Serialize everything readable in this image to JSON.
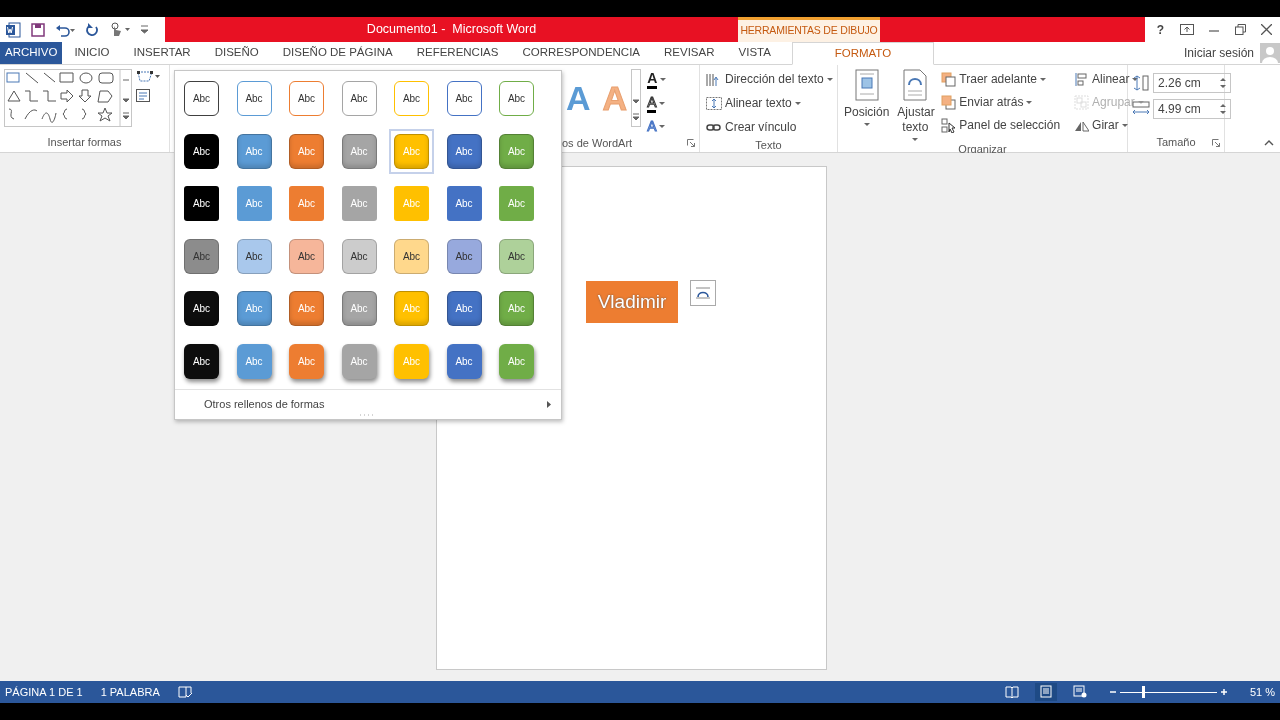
{
  "window": {
    "title": "Documento1 -  Microsoft Word",
    "context_group": "HERRAMIENTAS DE DIBUJO",
    "help": "?",
    "sign_in": "Iniciar sesión"
  },
  "tabs": [
    {
      "label": "ARCHIVO",
      "kind": "file",
      "selected": false
    },
    {
      "label": "INICIO",
      "kind": "normal",
      "selected": false
    },
    {
      "label": "INSERTAR",
      "kind": "normal",
      "selected": false
    },
    {
      "label": "DISEÑO",
      "kind": "normal",
      "selected": false
    },
    {
      "label": "DISEÑO DE PÁGINA",
      "kind": "normal",
      "selected": false
    },
    {
      "label": "REFERENCIAS",
      "kind": "normal",
      "selected": false
    },
    {
      "label": "CORRESPONDENCIA",
      "kind": "normal",
      "selected": false
    },
    {
      "label": "REVISAR",
      "kind": "normal",
      "selected": false
    },
    {
      "label": "VISTA",
      "kind": "normal",
      "selected": false
    },
    {
      "label": "FORMATO",
      "kind": "context",
      "selected": true
    }
  ],
  "ribbon": {
    "insert_shapes": {
      "label": "Insertar formas"
    },
    "wordart": {
      "label": "os de WordArt",
      "quick_styles": [
        {
          "glyph": "A",
          "color": "#5b9bd5"
        },
        {
          "glyph": "A",
          "color": "#f4b183"
        }
      ],
      "tools": [
        {
          "glyph": "A",
          "kind": "fill"
        },
        {
          "glyph": "A",
          "kind": "outline"
        },
        {
          "glyph": "A",
          "kind": "effects"
        }
      ]
    },
    "text": {
      "label": "Texto",
      "items": [
        {
          "label": "Dirección del texto",
          "kind": "direction",
          "dropdown": true
        },
        {
          "label": "Alinear texto",
          "kind": "align",
          "dropdown": true
        },
        {
          "label": "Crear vínculo",
          "kind": "link",
          "dropdown": false
        }
      ]
    },
    "arrange": {
      "label": "Organizar",
      "large": [
        {
          "label": "Posición",
          "kind": "position"
        },
        {
          "label": "Ajustar texto",
          "kind": "wrap"
        }
      ],
      "small": [
        {
          "label": "Traer adelante",
          "kind": "forward",
          "disabled": false
        },
        {
          "label": "Enviar atrás",
          "kind": "backward",
          "disabled": false
        },
        {
          "label": "Panel de selección",
          "kind": "pane",
          "disabled": false
        },
        {
          "label": "Alinear",
          "kind": "align",
          "disabled": false
        },
        {
          "label": "Agrupar",
          "kind": "group",
          "disabled": true
        },
        {
          "label": "Girar",
          "kind": "rotate",
          "disabled": false
        }
      ]
    },
    "size": {
      "label": "Tamaño",
      "height": "2.26 cm",
      "width": "4.99 cm"
    }
  },
  "gallery": {
    "rows": [
      {
        "kind": "outline",
        "swatches": [
          {
            "label": "Abc",
            "color": "#404040",
            "selected": false
          },
          {
            "label": "Abc",
            "color": "#5b9bd5",
            "selected": false
          },
          {
            "label": "Abc",
            "color": "#ed7d31",
            "selected": false
          },
          {
            "label": "Abc",
            "color": "#a5a5a5",
            "selected": false
          },
          {
            "label": "Abc",
            "color": "#ffc000",
            "selected": false
          },
          {
            "label": "Abc",
            "color": "#4472c4",
            "selected": false
          },
          {
            "label": "Abc",
            "color": "#70ad47",
            "selected": false
          }
        ]
      },
      {
        "kind": "solid",
        "swatches": [
          {
            "label": "Abc",
            "color": "#000000",
            "selected": false
          },
          {
            "label": "Abc",
            "color": "#5b9bd5",
            "selected": false
          },
          {
            "label": "Abc",
            "color": "#ed7d31",
            "selected": false
          },
          {
            "label": "Abc",
            "color": "#a5a5a5",
            "selected": false
          },
          {
            "label": "Abc",
            "color": "#ffc000",
            "selected": true
          },
          {
            "label": "Abc",
            "color": "#4472c4",
            "selected": false
          },
          {
            "label": "Abc",
            "color": "#70ad47",
            "selected": false
          }
        ]
      },
      {
        "kind": "flat",
        "swatches": [
          {
            "label": "Abc",
            "color": "#000000",
            "selected": false
          },
          {
            "label": "Abc",
            "color": "#5b9bd5",
            "selected": false
          },
          {
            "label": "Abc",
            "color": "#ed7d31",
            "selected": false
          },
          {
            "label": "Abc",
            "color": "#a5a5a5",
            "selected": false
          },
          {
            "label": "Abc",
            "color": "#ffc000",
            "selected": false
          },
          {
            "label": "Abc",
            "color": "#4472c4",
            "selected": false
          },
          {
            "label": "Abc",
            "color": "#70ad47",
            "selected": false
          }
        ]
      },
      {
        "kind": "light",
        "swatches": [
          {
            "label": "Abc",
            "color": "#8c8c8c",
            "selected": false
          },
          {
            "label": "Abc",
            "color": "#a9c8ec",
            "selected": false
          },
          {
            "label": "Abc",
            "color": "#f6b69a",
            "selected": false
          },
          {
            "label": "Abc",
            "color": "#cccccc",
            "selected": false
          },
          {
            "label": "Abc",
            "color": "#ffd88c",
            "selected": false
          },
          {
            "label": "Abc",
            "color": "#97a9dd",
            "selected": false
          },
          {
            "label": "Abc",
            "color": "#aed19a",
            "selected": false
          }
        ]
      },
      {
        "kind": "solid",
        "swatches": [
          {
            "label": "Abc",
            "color": "#0d0d0d",
            "selected": false
          },
          {
            "label": "Abc",
            "color": "#5b9bd5",
            "selected": false
          },
          {
            "label": "Abc",
            "color": "#ed7d31",
            "selected": false
          },
          {
            "label": "Abc",
            "color": "#a5a5a5",
            "selected": false
          },
          {
            "label": "Abc",
            "color": "#ffc000",
            "selected": false
          },
          {
            "label": "Abc",
            "color": "#4472c4",
            "selected": false
          },
          {
            "label": "Abc",
            "color": "#70ad47",
            "selected": false
          }
        ]
      },
      {
        "kind": "shadow",
        "swatches": [
          {
            "label": "Abc",
            "color": "#0d0d0d",
            "selected": false
          },
          {
            "label": "Abc",
            "color": "#5b9bd5",
            "selected": false
          },
          {
            "label": "Abc",
            "color": "#ed7d31",
            "selected": false
          },
          {
            "label": "Abc",
            "color": "#a5a5a5",
            "selected": false
          },
          {
            "label": "Abc",
            "color": "#ffc000",
            "selected": false
          },
          {
            "label": "Abc",
            "color": "#4472c4",
            "selected": false
          },
          {
            "label": "Abc",
            "color": "#70ad47",
            "selected": false
          }
        ]
      }
    ],
    "more": "Otros rellenos de formas"
  },
  "document": {
    "shape": {
      "text": "Vladimir",
      "color": "#ed7d31"
    }
  },
  "status_bar": {
    "page": "PÁGINA 1 DE 1",
    "words": "1 PALABRA",
    "views": [
      {
        "kind": "read",
        "selected": false
      },
      {
        "kind": "print",
        "selected": true
      },
      {
        "kind": "web",
        "selected": false
      }
    ],
    "zoom": {
      "level": 0.23,
      "reading": "51 %"
    }
  }
}
